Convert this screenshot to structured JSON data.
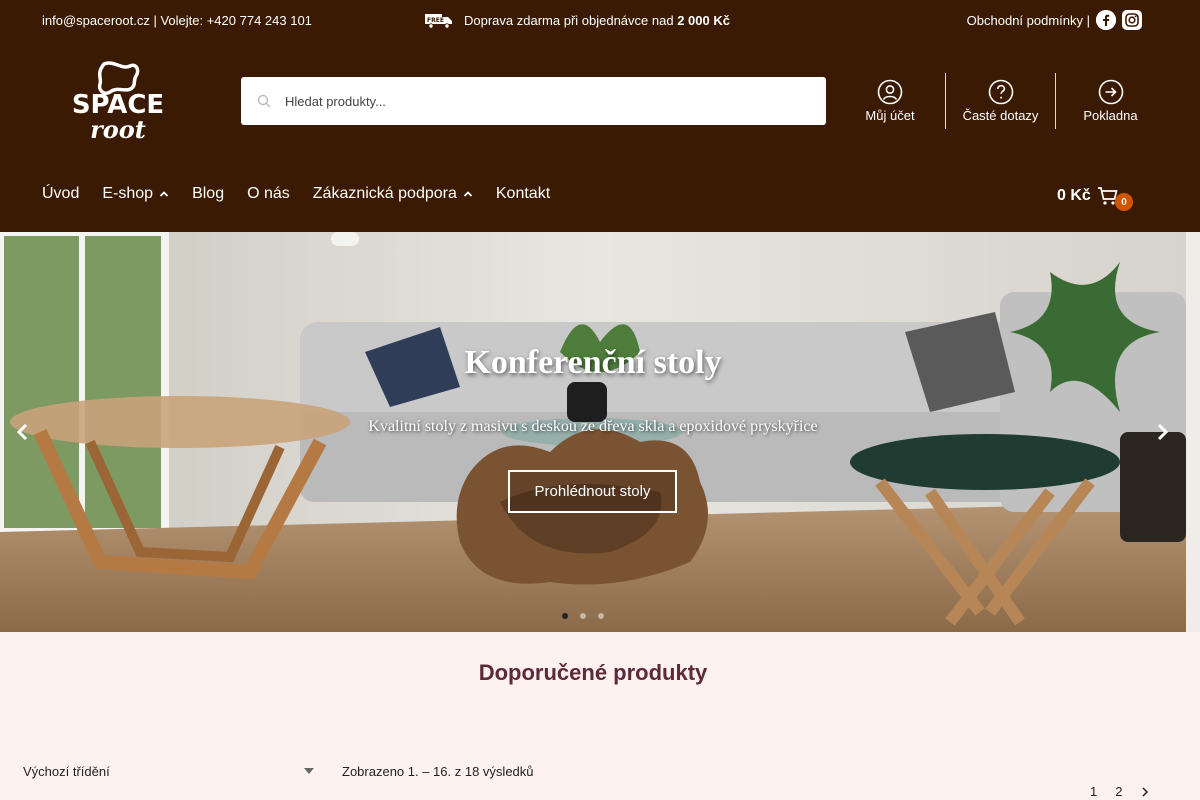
{
  "topbar": {
    "contact": "info@spaceroot.cz | Volejte: +420 774 243 101",
    "shipping_text": "Doprava zdarma při objednávce nad",
    "shipping_amount": "2 000 Kč",
    "terms": "Obchodní podmínky |",
    "truck_badge": "FREE"
  },
  "logo": {
    "line1": "SPACE",
    "line2": "root"
  },
  "search": {
    "placeholder": "Hledat produkty..."
  },
  "account": {
    "items": [
      {
        "label": "Můj účet",
        "icon": "user-circle-icon"
      },
      {
        "label": "Časté dotazy",
        "icon": "question-circle-icon"
      },
      {
        "label": "Pokladna",
        "icon": "arrow-right-circle-icon"
      }
    ]
  },
  "nav": {
    "items": [
      {
        "label": "Úvod"
      },
      {
        "label": "E-shop"
      },
      {
        "label": "Blog"
      },
      {
        "label": "O nás"
      },
      {
        "label": "Zákaznická podpora"
      },
      {
        "label": "Kontakt"
      }
    ]
  },
  "cart": {
    "total": "0 Kč",
    "count": "0"
  },
  "hero": {
    "title": "Konferenční stoly",
    "subtitle": "Kvalitní stoly z masivu s deskou ze dřeva skla a epoxidové pryskyřice",
    "button": "Prohlédnout stoly",
    "active_slide": 1
  },
  "products": {
    "title": "Doporučené produkty",
    "sort_label": "Výchozí třídění",
    "results": "Zobrazeno 1. – 16. z 18 výsledků",
    "pages": [
      "1",
      "2"
    ]
  },
  "colors": {
    "header_bg": "#3b1a03",
    "page_bg": "#fdf2ef",
    "accent": "#d35400",
    "title": "#5c2a3a"
  }
}
